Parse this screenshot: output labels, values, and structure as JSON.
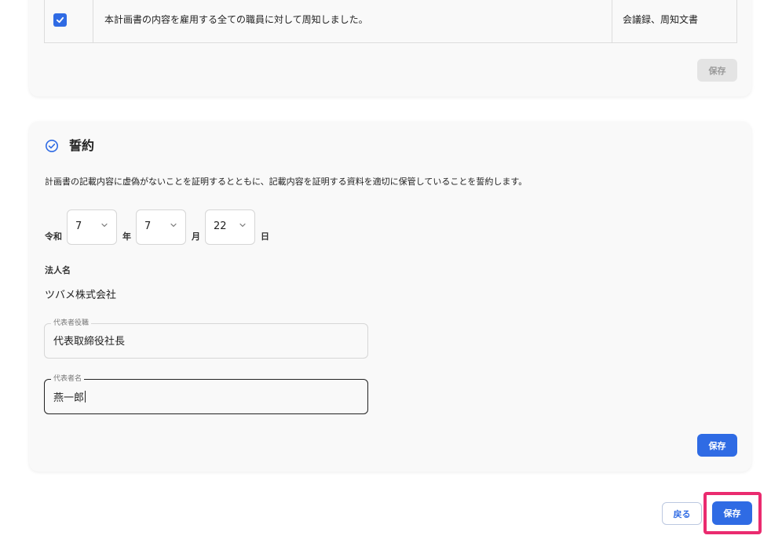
{
  "plan_table": {
    "row": {
      "checked": true,
      "text": "本計画書の内容を雇用する全ての職員に対して周知しました。",
      "documents": "会議録、周知文書"
    },
    "save_label": "保存"
  },
  "pledge": {
    "title": "誓約",
    "description": "計画書の記載内容に虚偽がないことを証明するとともに、記載内容を証明する資料を適切に保管していることを誓約します。",
    "era_label": "令和",
    "year": "7",
    "year_unit": "年",
    "month": "7",
    "month_unit": "月",
    "day": "22",
    "day_unit": "日",
    "corporation_label": "法人名",
    "corporation_name": "ツバメ株式会社",
    "representative_title_label": "代表者役職",
    "representative_title_value": "代表取締役社長",
    "representative_name_label": "代表者名",
    "representative_name_value": "燕一郎",
    "save_label": "保存"
  },
  "footer": {
    "back_label": "戻る",
    "save_label": "保存"
  },
  "colors": {
    "primary": "#2f6be4",
    "highlight": "#ea2b6f"
  }
}
